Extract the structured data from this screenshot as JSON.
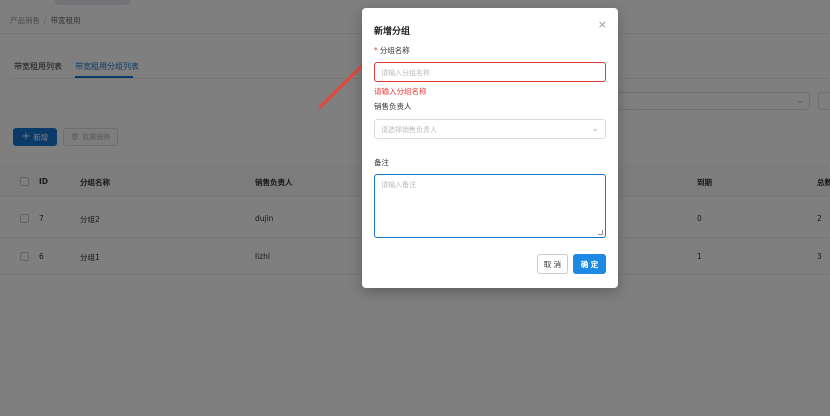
{
  "breadcrumb": {
    "parent": "产品销售",
    "separator": "/",
    "current": "带宽租用"
  },
  "tabs": [
    {
      "label": "带宽租用列表"
    },
    {
      "label": "带宽租用分组列表"
    }
  ],
  "toolbar": {
    "new_label": "新增",
    "bulk_delete_label": "批量删除"
  },
  "table": {
    "columns": [
      "ID",
      "分组名称",
      "销售负责人",
      "到期",
      "总数"
    ],
    "rows": [
      {
        "id": "7",
        "name": "分组2",
        "owner": "dujin",
        "due": "0",
        "total": "2"
      },
      {
        "id": "6",
        "name": "分组1",
        "owner": "lizhl",
        "due": "1",
        "total": "3"
      }
    ]
  },
  "modal": {
    "title": "新增分组",
    "close_icon": "×",
    "group_name_label": "分组名称",
    "required_mark": "*",
    "group_name_placeholder": "请输入分组名称",
    "group_name_error": "请输入分组名称",
    "owner_label": "销售负责人",
    "owner_placeholder": "请选择销售负责人",
    "remark_label": "备注",
    "remark_placeholder": "请输入备注",
    "cancel_label": "取 消",
    "confirm_label": "确 定"
  },
  "colors": {
    "primary": "#1976d2",
    "error": "#e53935",
    "arrow": "#e5483b"
  }
}
